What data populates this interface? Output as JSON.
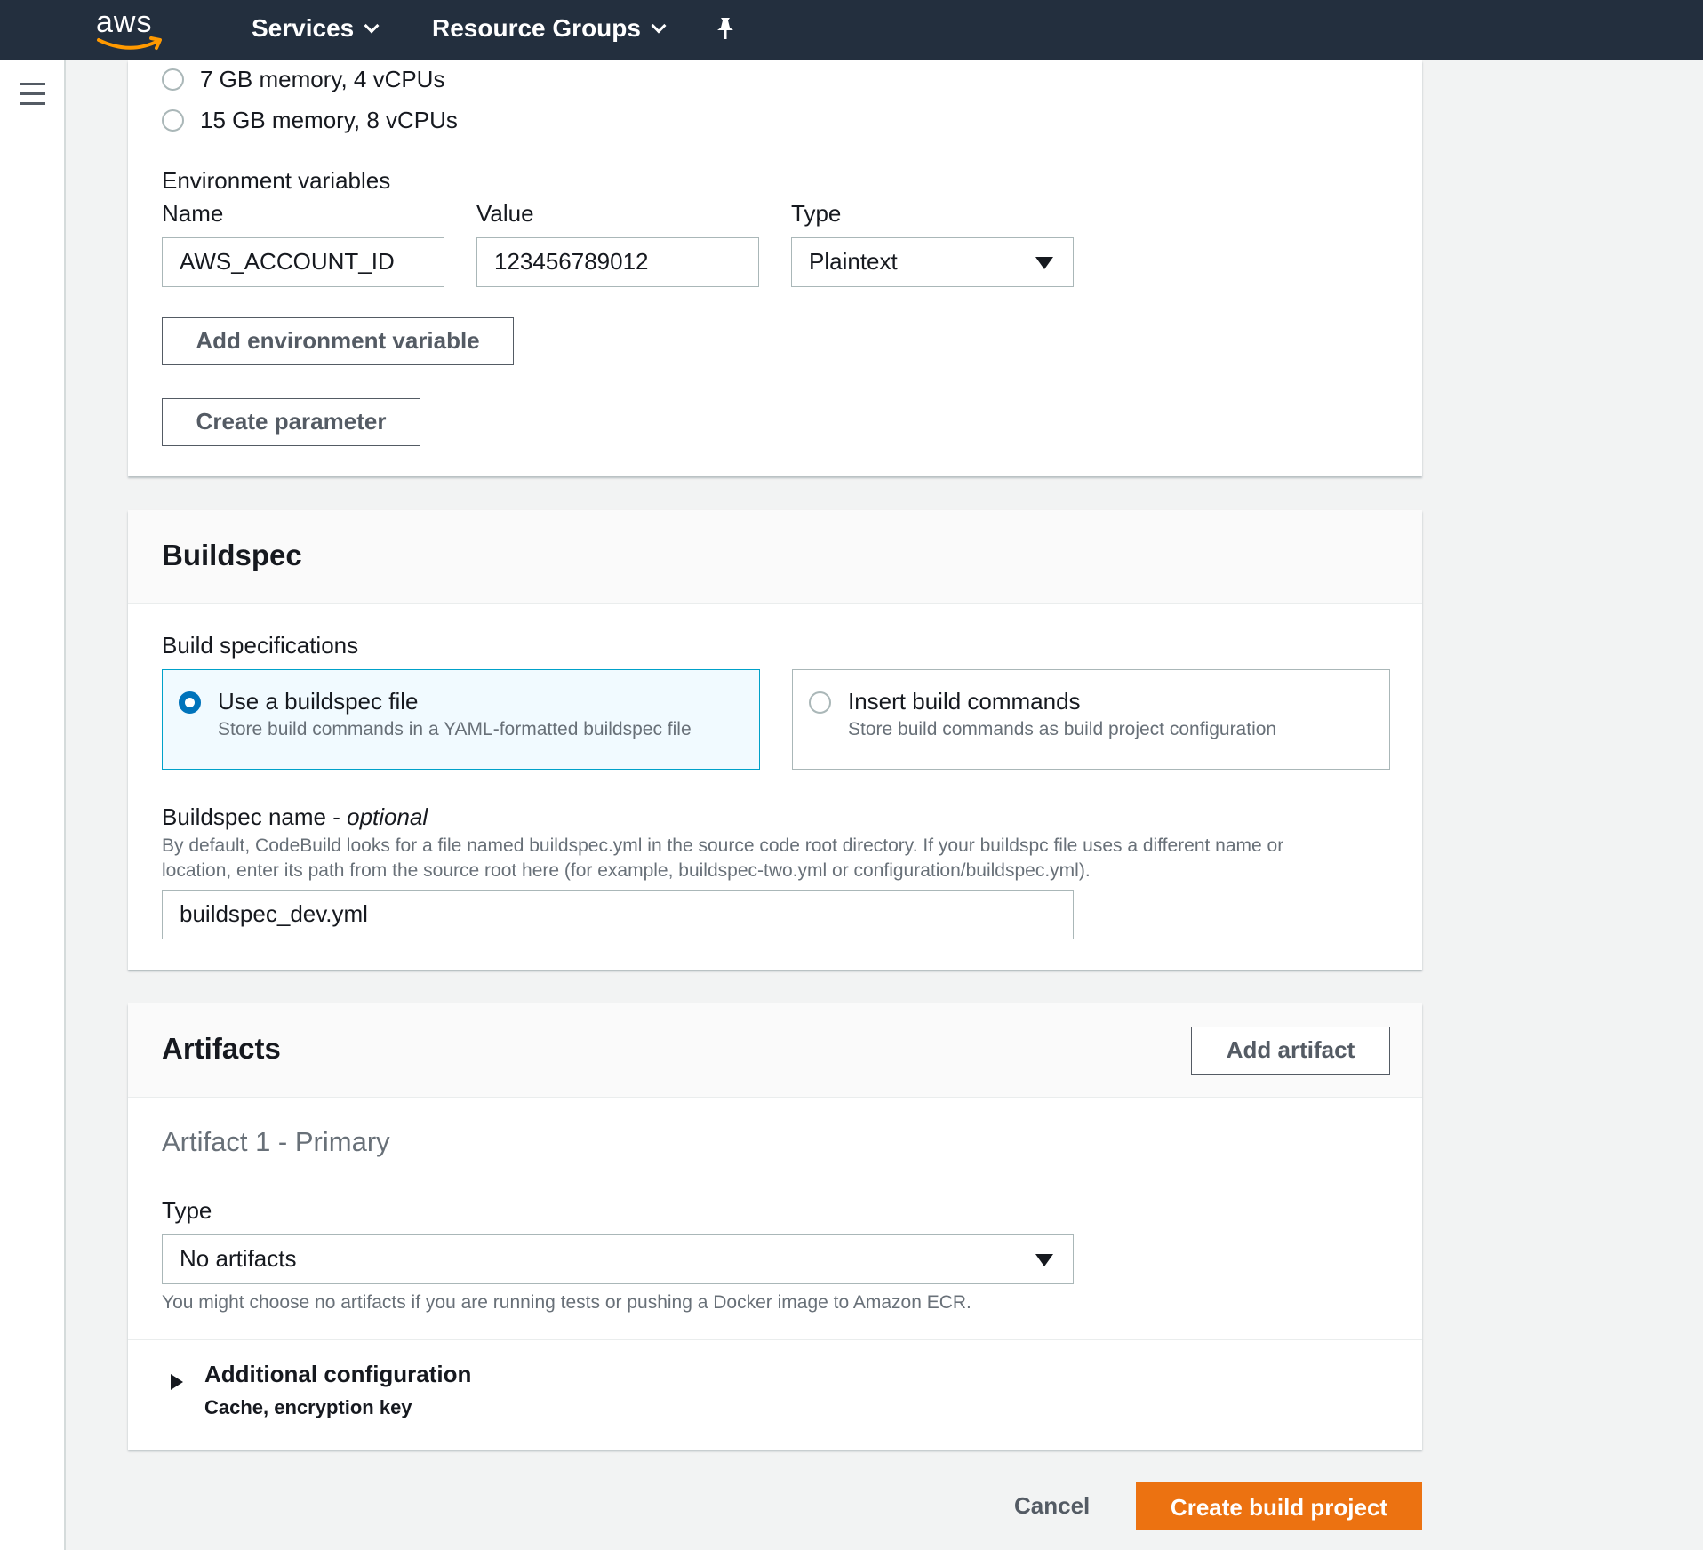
{
  "topbar": {
    "logo_text": "aws",
    "services_label": "Services",
    "resource_groups_label": "Resource Groups"
  },
  "environment": {
    "memory_options": [
      "7 GB memory, 4 vCPUs",
      "15 GB memory, 8 vCPUs"
    ],
    "env_vars_title": "Environment variables",
    "col_name": "Name",
    "col_value": "Value",
    "col_type": "Type",
    "var_name": "AWS_ACCOUNT_ID",
    "var_value": "123456789012",
    "var_type": "Plaintext",
    "add_env_var_label": "Add environment variable",
    "create_param_label": "Create parameter"
  },
  "buildspec": {
    "title": "Buildspec",
    "spec_label": "Build specifications",
    "option1_title": "Use a buildspec file",
    "option1_desc": "Store build commands in a YAML-formatted buildspec file",
    "option2_title": "Insert build commands",
    "option2_desc": "Store build commands as build project configuration",
    "name_label": "Buildspec name - ",
    "name_optional": "optional",
    "name_help_line1": "By default, CodeBuild looks for a file named buildspec.yml in the source code root directory. If your buildspc file uses a different name or",
    "name_help_line2": "location, enter its path from the source root here (for example, buildspec-two.yml or configuration/buildspec.yml).",
    "name_value": "buildspec_dev.yml"
  },
  "artifacts": {
    "title": "Artifacts",
    "add_artifact_label": "Add artifact",
    "artifact_heading": "Artifact 1 - Primary",
    "type_label": "Type",
    "type_value": "No artifacts",
    "type_help": "You might choose no artifacts if you are running tests or pushing a Docker image to Amazon ECR.",
    "additional_config_label": "Additional configuration",
    "additional_config_sub": "Cache, encryption key"
  },
  "footer": {
    "cancel_label": "Cancel",
    "create_label": "Create build project"
  },
  "colors": {
    "topbar": "#232f3e",
    "primary": "#ec7211",
    "radio_selected": "#0073bb",
    "tile_selected_border": "#00a1c9"
  }
}
